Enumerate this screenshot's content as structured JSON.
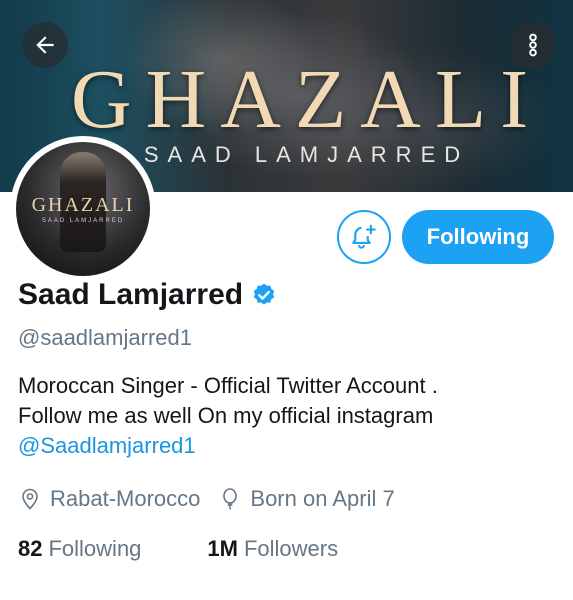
{
  "banner": {
    "title": "GHAZALI",
    "subtitle": "SAAD LAMJARRED",
    "back_icon": "arrow-left-icon",
    "more_icon": "more-vertical-icon"
  },
  "avatar": {
    "title": "GHAZALI",
    "subtitle": "SAAD LAMJARRED"
  },
  "actions": {
    "notify_icon": "bell-plus-icon",
    "following_label": "Following"
  },
  "profile": {
    "name": "Saad Lamjarred",
    "verified_icon": "verified-badge-icon",
    "handle": "@saadlamjarred1",
    "bio_line1": "Moroccan Singer - Official Twitter Account  .",
    "bio_line2": "Follow me as well On my official instagram",
    "bio_link": "@Saadlamjarred1",
    "location": "Rabat-Morocco",
    "birthday": "Born on April 7"
  },
  "stats": {
    "following_count": "82",
    "following_label": "Following",
    "followers_count": "1M",
    "followers_label": "Followers"
  },
  "colors": {
    "accent": "#1da1f2",
    "link": "#1b95e0",
    "secondary_text": "#657786"
  }
}
